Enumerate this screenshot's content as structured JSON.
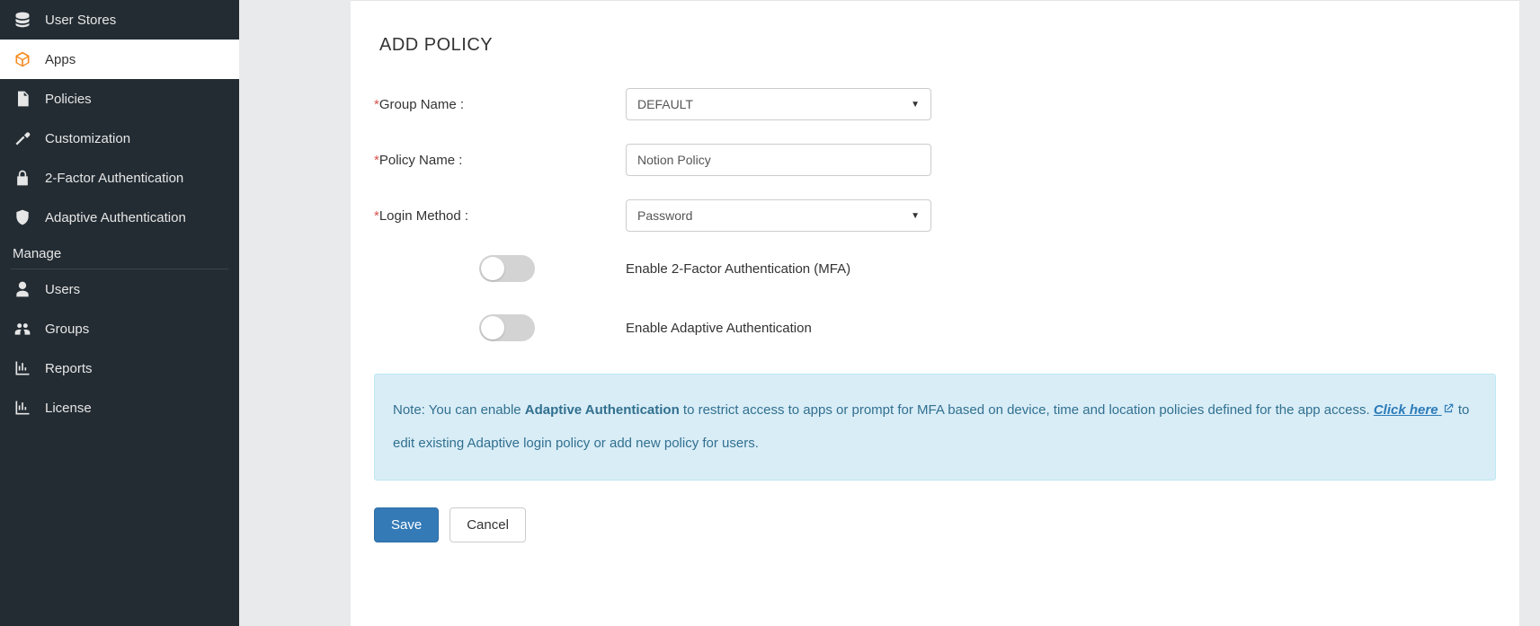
{
  "sidebar": {
    "items": [
      {
        "label": "User Stores"
      },
      {
        "label": "Apps"
      },
      {
        "label": "Policies"
      },
      {
        "label": "Customization"
      },
      {
        "label": "2-Factor Authentication"
      },
      {
        "label": "Adaptive Authentication"
      }
    ],
    "sectionTitle": "Manage",
    "manageItems": [
      {
        "label": "Users"
      },
      {
        "label": "Groups"
      },
      {
        "label": "Reports"
      },
      {
        "label": "License"
      }
    ]
  },
  "page": {
    "title": "ADD POLICY"
  },
  "form": {
    "groupName": {
      "label": "Group Name :",
      "value": "DEFAULT"
    },
    "policyName": {
      "label": "Policy Name :",
      "value": "Notion Policy"
    },
    "loginMethod": {
      "label": "Login Method :",
      "value": "Password"
    },
    "mfaToggleLabel": "Enable 2-Factor Authentication (MFA)",
    "adaptiveToggleLabel": "Enable Adaptive Authentication"
  },
  "note": {
    "prefix": "Note: You can enable ",
    "boldText": "Adaptive Authentication",
    "mid": " to restrict access to apps or prompt for MFA based on device, time and location policies defined for the app access. ",
    "linkText": "Click here",
    "suffix": " to edit existing Adaptive login policy or add new policy for users."
  },
  "buttons": {
    "save": "Save",
    "cancel": "Cancel"
  }
}
